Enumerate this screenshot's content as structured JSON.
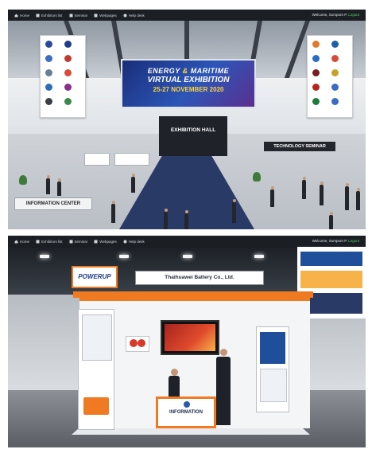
{
  "screens": [
    {
      "nav": {
        "items": [
          {
            "label": "Home",
            "icon": "home-icon"
          },
          {
            "label": "Exhibitors list",
            "icon": "list-icon"
          },
          {
            "label": "Seminar",
            "icon": "seminar-icon"
          },
          {
            "label": "Webpages",
            "icon": "webpage-icon"
          },
          {
            "label": "Help desk",
            "icon": "help-icon"
          }
        ],
        "welcome": "Welcome, Somporn P.",
        "welcome_link": "Logout"
      },
      "scene": {
        "banner_title_a": "ENERGY",
        "banner_title_amp": "&",
        "banner_title_b": "MARITIME",
        "banner_subtitle": "VIRTUAL EXHIBITION",
        "banner_dates": "25-27 NOVEMBER 2020",
        "hall_label": "EXHIBITION HALL",
        "technology_label": "TECHNOLOGY SEMINAR",
        "information_label": "INFORMATION CENTER"
      }
    },
    {
      "nav": {
        "items": [
          {
            "label": "Home",
            "icon": "home-icon"
          },
          {
            "label": "Exhibitors list",
            "icon": "list-icon"
          },
          {
            "label": "Seminar",
            "icon": "seminar-icon"
          },
          {
            "label": "Webpages",
            "icon": "webpage-icon"
          },
          {
            "label": "Help desk",
            "icon": "help-icon"
          }
        ],
        "welcome": "Welcome, Somporn P.",
        "welcome_link": "Logout"
      },
      "scene": {
        "company_name": "Thaihuawei Battery Co., Ltd.",
        "brand_logo": "POWERUP",
        "desk_label": "INFORMATION"
      }
    }
  ],
  "colors": {
    "navbar_bg": "#1b1f24",
    "accent_orange": "#f07a22",
    "banner_blue": "#2c56b8",
    "banner_yellow": "#ffd23a"
  }
}
